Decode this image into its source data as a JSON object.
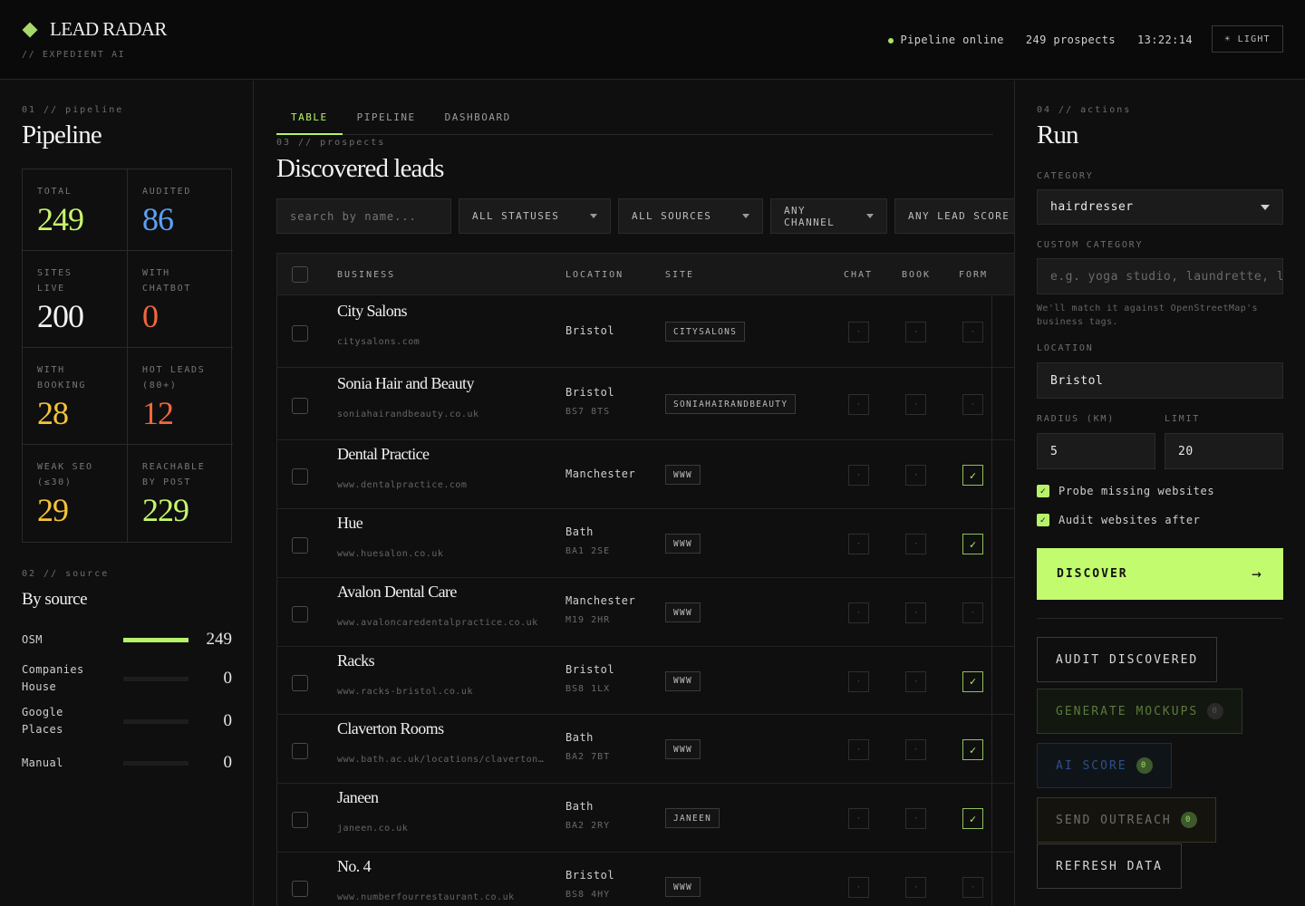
{
  "header": {
    "logo_text": "LEAD RADAR",
    "tagline": "// EXPEDIENT AI",
    "pipeline_status": "Pipeline online",
    "prospects": "249 prospects",
    "clock": "13:22:14",
    "theme_button": "☀ LIGHT"
  },
  "pipeline": {
    "kicker": "01 // pipeline",
    "title": "Pipeline",
    "stats": [
      {
        "label": "TOTAL",
        "value": "249",
        "color": "#c7f56f"
      },
      {
        "label": "AUDITED",
        "value": "86",
        "color": "#5aa2f5"
      },
      {
        "label": "SITES LIVE",
        "value": "200",
        "color": "#f2f2f2"
      },
      {
        "label": "WITH CHATBOT",
        "value": "0",
        "color": "#f2673c"
      },
      {
        "label": "WITH BOOKING",
        "value": "28",
        "color": "#f5c33a"
      },
      {
        "label": "HOT LEADS (80+)",
        "value": "12",
        "color": "#f2673c"
      },
      {
        "label": "WEAK SEO (≤30)",
        "value": "29",
        "color": "#f5c33a"
      },
      {
        "label": "REACHABLE BY POST",
        "value": "229",
        "color": "#c7f56f"
      }
    ]
  },
  "source": {
    "kicker": "02 // source",
    "title": "By source",
    "rows": [
      {
        "label": "OSM",
        "value": "249",
        "fraction": 1
      },
      {
        "label": "Companies House",
        "value": "0",
        "fraction": 0
      },
      {
        "label": "Google Places",
        "value": "0",
        "fraction": 0
      },
      {
        "label": "Manual",
        "value": "0",
        "fraction": 0
      }
    ]
  },
  "tabs": [
    "TABLE",
    "PIPELINE",
    "DASHBOARD"
  ],
  "prospects": {
    "kicker": "03 // prospects",
    "title": "Discovered leads",
    "search_placeholder": "search by name...",
    "filters": [
      "ALL STATUSES",
      "ALL SOURCES",
      "ANY CHANNEL",
      "ANY LEAD SCORE"
    ],
    "columns": [
      "BUSINESS",
      "LOCATION",
      "SITE",
      "CHAT",
      "BOOK",
      "FORM"
    ],
    "rows": [
      {
        "name": "City Salons",
        "url": "citysalons.com",
        "city": "Bristol",
        "postcode": "",
        "site": "CITYSALONS",
        "chat": "·",
        "book": "·",
        "form": "·"
      },
      {
        "name": "Sonia Hair and Beauty",
        "url": "soniahairandbeauty.co.uk",
        "city": "Bristol",
        "postcode": "BS7 8TS",
        "site": "SONIAHAIRANDBEAUTY",
        "chat": "·",
        "book": "·",
        "form": "·"
      },
      {
        "name": "Dental Practice",
        "url": "www.dentalpractice.com",
        "city": "Manchester",
        "postcode": "",
        "site": "WWW",
        "chat": "·",
        "book": "·",
        "form": "✓"
      },
      {
        "name": "Hue",
        "url": "www.huesalon.co.uk",
        "city": "Bath",
        "postcode": "BA1 2SE",
        "site": "WWW",
        "chat": "·",
        "book": "·",
        "form": "✓"
      },
      {
        "name": "Avalon Dental Care",
        "url": "www.avaloncaredentalpractice.co.uk",
        "city": "Manchester",
        "postcode": "M19 2HR",
        "site": "WWW",
        "chat": "·",
        "book": "·",
        "form": "·"
      },
      {
        "name": "Racks",
        "url": "www.racks-bristol.co.uk",
        "city": "Bristol",
        "postcode": "BS8 1LX",
        "site": "WWW",
        "chat": "·",
        "book": "·",
        "form": "✓"
      },
      {
        "name": "Claverton Rooms",
        "url": "www.bath.ac.uk/locations/claverton-rooms",
        "city": "Bath",
        "postcode": "BA2 7BT",
        "site": "WWW",
        "chat": "·",
        "book": "·",
        "form": "✓"
      },
      {
        "name": "Janeen",
        "url": "janeen.co.uk",
        "city": "Bath",
        "postcode": "BA2 2RY",
        "site": "JANEEN",
        "chat": "·",
        "book": "·",
        "form": "✓"
      },
      {
        "name": "No. 4",
        "url": "www.numberfourrestaurant.co.uk",
        "city": "Bristol",
        "postcode": "BS8 4HY",
        "site": "WWW",
        "chat": "·",
        "book": "·",
        "form": "·"
      }
    ]
  },
  "actions": {
    "kicker": "04 // actions",
    "title": "Run",
    "category_label": "CATEGORY",
    "category_value": "hairdresser",
    "custom_label": "CUSTOM CATEGORY",
    "custom_placeholder": "e.g. yoga studio, laundrette, locksmith",
    "custom_hint": "We'll match it against OpenStreetMap's business tags.",
    "location_label": "LOCATION",
    "location_value": "Bristol",
    "radius_label": "RADIUS (KM)",
    "radius_value": "5",
    "limit_label": "LIMIT",
    "limit_value": "20",
    "probe_label": "Probe missing websites",
    "audit_after_label": "Audit websites after",
    "discover_label": "DISCOVER",
    "audit_label": "AUDIT DISCOVERED",
    "mockups_label": "GENERATE MOCKUPS",
    "mockups_count": "0",
    "ai_label": "AI SCORE",
    "ai_count": "0",
    "outreach_label": "SEND OUTREACH",
    "outreach_count": "0",
    "refresh_label": "REFRESH DATA"
  },
  "colors": {
    "accent": "#c3fb6e",
    "blue": "#5aa2f5",
    "red": "#f2673c",
    "yellow": "#f5c33a"
  }
}
